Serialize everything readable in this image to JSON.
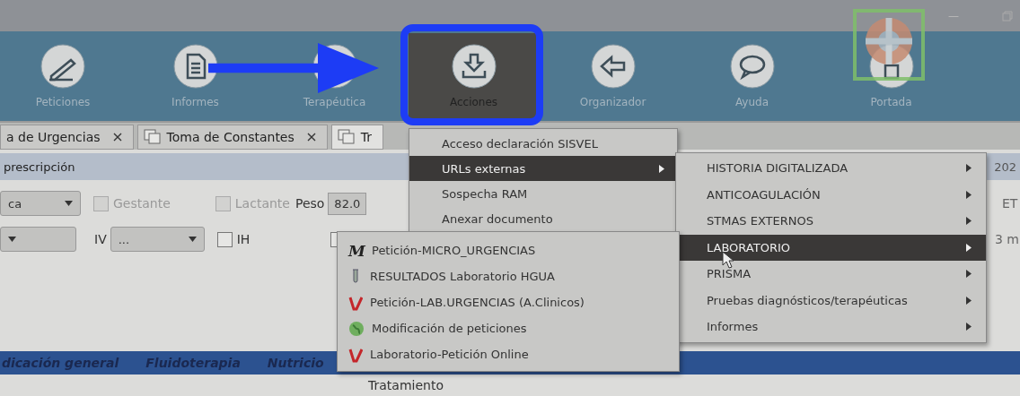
{
  "window_controls": {
    "minimize": "—"
  },
  "toolbar": [
    {
      "label": "Peticiones",
      "selected": false
    },
    {
      "label": "Informes",
      "selected": false
    },
    {
      "label": "Terapéutica",
      "selected": false
    },
    {
      "label": "Acciones",
      "selected": true
    },
    {
      "label": "Organizador",
      "selected": false
    },
    {
      "label": "Ayuda",
      "selected": false
    },
    {
      "label": "Portada",
      "selected": false
    }
  ],
  "tabs": [
    {
      "label": "a de Urgencias",
      "closable": true,
      "selected": false
    },
    {
      "label": "Toma de Constantes",
      "closable": true,
      "selected": false
    },
    {
      "label": "Tr",
      "closable": false,
      "selected": true
    }
  ],
  "section_title": "prescripción",
  "edge_texts": [
    "202",
    "ET",
    "3 m"
  ],
  "form": {
    "combo_1": "ca",
    "checks_1": [
      {
        "label": "Gestante",
        "checked": false,
        "disabled": true
      },
      {
        "label": "Lactante",
        "checked": false,
        "disabled": true
      }
    ],
    "weight_label": "Peso",
    "weight_value": "82.0",
    "iv_label": "IV",
    "iv_value": "...",
    "checks_2": [
      {
        "label": "IH",
        "checked": false,
        "disabled": false
      },
      {
        "checked": false,
        "disabled": false
      }
    ]
  },
  "bottom_tabs": [
    "dicación general",
    "Fluidoterapia",
    "Nutricio"
  ],
  "footer_heading": "Tratamiento",
  "menu": [
    {
      "label": "Acceso declaración SISVEL",
      "selected": false,
      "submenu": false
    },
    {
      "label": "URLs externas",
      "selected": true,
      "submenu": true
    },
    {
      "label": "Sospecha RAM",
      "selected": false,
      "submenu": false
    },
    {
      "label": "Anexar documento",
      "selected": false,
      "submenu": false
    }
  ],
  "submenu": [
    {
      "label": "HISTORIA DIGITALIZADA",
      "selected": false,
      "submenu": true
    },
    {
      "label": "ANTICOAGULACIÓN",
      "selected": false,
      "submenu": true
    },
    {
      "label": "STMAS EXTERNOS",
      "selected": false,
      "submenu": true
    },
    {
      "label": "LABORATORIO",
      "selected": true,
      "submenu": true
    },
    {
      "label": "PRISMA",
      "selected": false,
      "submenu": true
    },
    {
      "label": "Pruebas diagnósticos/terapéuticas",
      "selected": false,
      "submenu": true
    },
    {
      "label": "Informes",
      "selected": false,
      "submenu": true
    }
  ],
  "lab_menu": [
    {
      "label": "Petición-MICRO_URGENCIAS",
      "kind": "letter",
      "icon_text": "M"
    },
    {
      "label": "RESULTADOS Laboratorio HGUA",
      "kind": "tube"
    },
    {
      "label": "Petición-LAB.URGENCIAS (A.Clinicos)",
      "kind": "logo"
    },
    {
      "label": "Modificación de peticiones",
      "kind": "globe"
    },
    {
      "label": "Laboratorio-Petición Online",
      "kind": "logo"
    }
  ]
}
